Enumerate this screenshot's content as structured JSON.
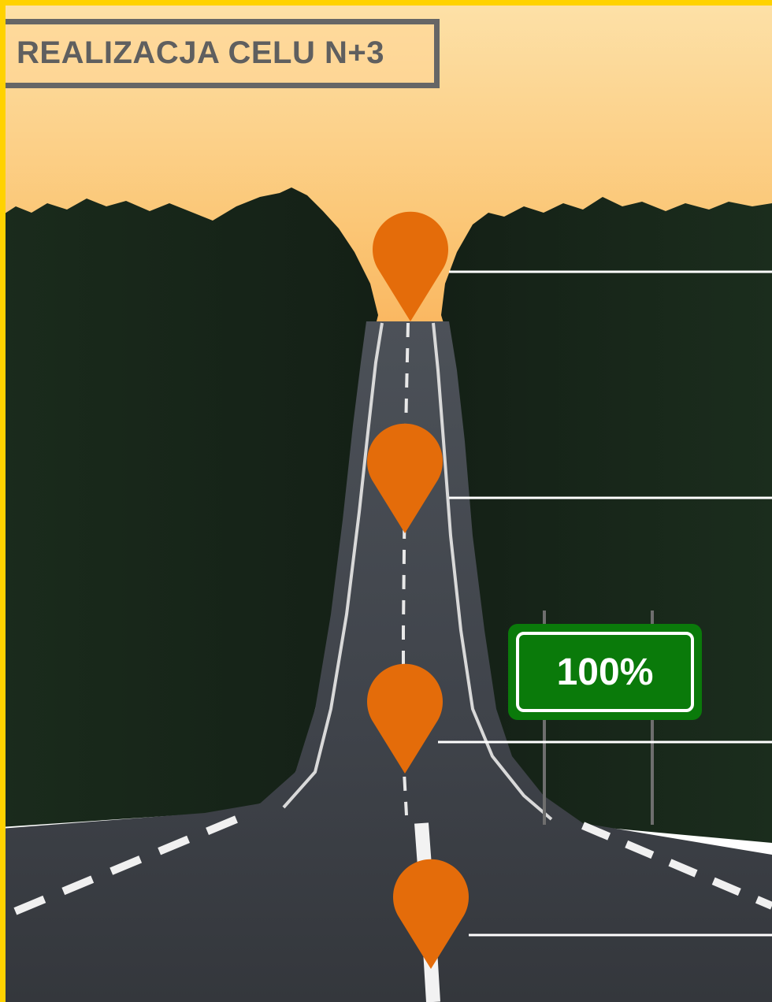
{
  "title": "REALIZACJA CELU N+3",
  "sign": {
    "label": "100%"
  },
  "colors": {
    "frame": "#ffd200",
    "title_border": "#666666",
    "title_text": "#5f5f5f",
    "marker": "#e46c0a",
    "sign_background": "#0a7a0a",
    "sign_text": "#ffffff"
  },
  "markers": [
    {
      "icon": "map-pin-icon"
    },
    {
      "icon": "map-pin-icon"
    },
    {
      "icon": "map-pin-icon"
    },
    {
      "icon": "map-pin-icon"
    }
  ]
}
